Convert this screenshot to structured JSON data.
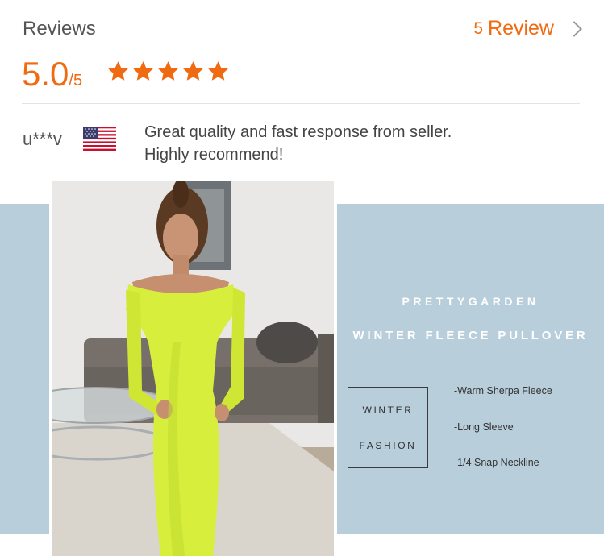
{
  "header": {
    "title": "Reviews",
    "review_count": "5",
    "review_label": "Review"
  },
  "rating": {
    "score": "5.0",
    "max": "/5",
    "stars": 5,
    "accent_color": "#f06a12"
  },
  "review": {
    "user": "u***v",
    "flag_icon": "us-flag-icon",
    "text_line1": "Great quality and fast response from seller.",
    "text_line2": "Highly recommend!"
  },
  "banner": {
    "brand": "PRETTYGARDEN",
    "subtitle": "WINTER FLEECE PULLOVER",
    "box_line1": "WINTER",
    "box_line2": "FASHION",
    "features": [
      "-Warm Sherpa Fleece",
      "-Long Sleeve",
      "-1/4 Snap Neckline"
    ],
    "background_color": "#b8cedb"
  }
}
